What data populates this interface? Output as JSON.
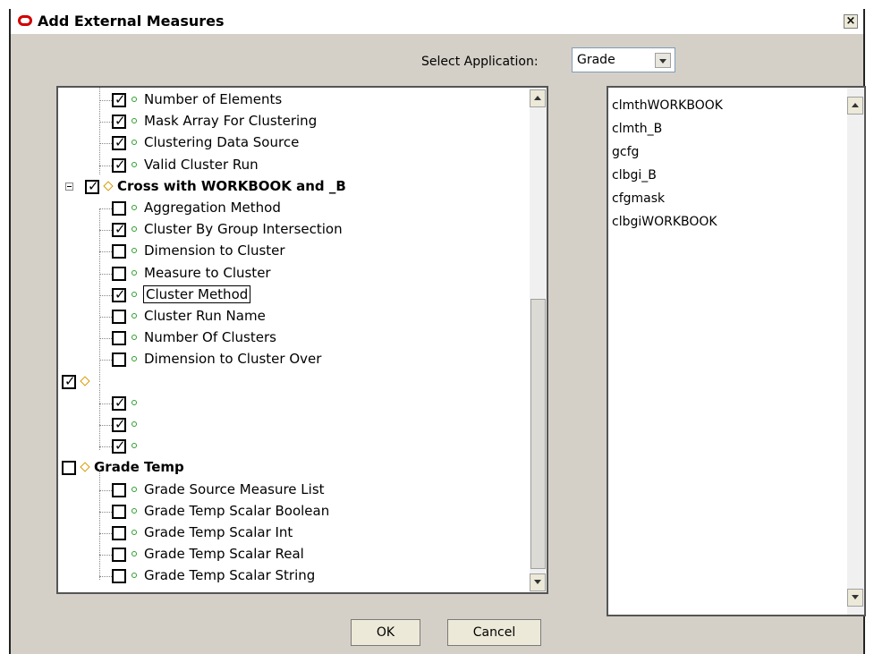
{
  "window": {
    "title": "Add External Measures",
    "close_label": "×"
  },
  "select_application": {
    "label": "Select Application:",
    "value": "Grade"
  },
  "tree_rows": [
    {
      "text": "Number of Elements",
      "checked": true,
      "type": "measure",
      "level": 1
    },
    {
      "text": "Mask Array For Clustering",
      "checked": true,
      "type": "measure",
      "level": 1
    },
    {
      "text": "Clustering Data Source",
      "checked": true,
      "type": "measure",
      "level": 1
    },
    {
      "text": "Valid Cluster Run",
      "checked": true,
      "type": "measure",
      "level": 1
    },
    {
      "text": "Cross with WORKBOOK and _B",
      "checked": true,
      "type": "group",
      "level": 0,
      "bold": true,
      "expandable": true
    },
    {
      "text": "Aggregation Method",
      "checked": false,
      "type": "measure",
      "level": 1
    },
    {
      "text": "Cluster By Group Intersection",
      "checked": true,
      "type": "measure",
      "level": 1
    },
    {
      "text": "Dimension to Cluster",
      "checked": false,
      "type": "measure",
      "level": 1
    },
    {
      "text": "Measure to Cluster",
      "checked": false,
      "type": "measure",
      "level": 1
    },
    {
      "text": "Cluster Method",
      "checked": true,
      "type": "measure",
      "level": 1,
      "focused": true
    },
    {
      "text": "Cluster Run Name",
      "checked": false,
      "type": "measure",
      "level": 1
    },
    {
      "text": "Number Of Clusters",
      "checked": false,
      "type": "measure",
      "level": 1
    },
    {
      "text": "Dimension to Cluster Over",
      "checked": false,
      "type": "measure",
      "level": 1
    },
    {
      "text": "",
      "checked": true,
      "type": "group",
      "level": 0
    },
    {
      "text": "",
      "checked": true,
      "type": "measure",
      "level": 1
    },
    {
      "text": "",
      "checked": true,
      "type": "measure",
      "level": 1
    },
    {
      "text": "",
      "checked": true,
      "type": "measure",
      "level": 1
    },
    {
      "text": "Grade Temp",
      "checked": false,
      "type": "group",
      "level": 0,
      "bold": true
    },
    {
      "text": "Grade Source Measure List",
      "checked": false,
      "type": "measure",
      "level": 1
    },
    {
      "text": "Grade Temp Scalar Boolean",
      "checked": false,
      "type": "measure",
      "level": 1
    },
    {
      "text": "Grade Temp Scalar Int",
      "checked": false,
      "type": "measure",
      "level": 1
    },
    {
      "text": "Grade Temp Scalar Real",
      "checked": false,
      "type": "measure",
      "level": 1
    },
    {
      "text": "Grade Temp Scalar String",
      "checked": false,
      "type": "measure",
      "level": 1
    }
  ],
  "workbooks": [
    "clmthWORKBOOK",
    "clmth_B",
    "gcfg",
    "clbgi_B",
    "cfgmask",
    "clbgiWORKBOOK"
  ],
  "buttons": {
    "ok": "OK",
    "cancel": "Cancel"
  },
  "colors": {
    "dialog_bg": "#d4d0c8",
    "measure_node": "#2e9d2e",
    "group_node": "#d99a00",
    "logo": "#d10000"
  }
}
